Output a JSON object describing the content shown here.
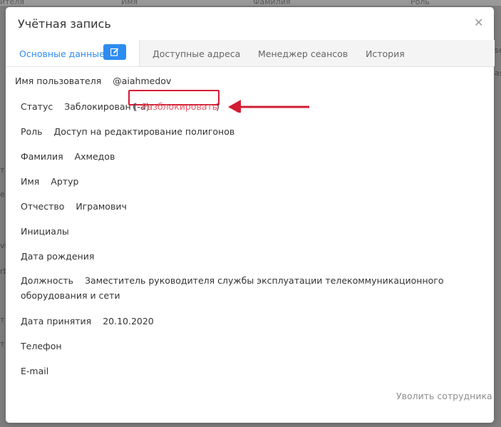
{
  "background": {
    "header_cells": [
      "ителя",
      "Имя",
      "Фамилия",
      "Роль"
    ],
    "edge_fragments": [
      "т",
      "е",
      "vi",
      "rb",
      "т",
      "т"
    ],
    "right_fragments": [
      "se",
      "as"
    ]
  },
  "modal": {
    "title": "Учётная запись",
    "tabs": [
      {
        "label": "Основные данные"
      },
      {
        "label": "Доступные адреса"
      },
      {
        "label": "Менеджер сеансов"
      },
      {
        "label": "История"
      }
    ],
    "fields": {
      "username": {
        "label": "Имя пользователя",
        "value": "@aiahmedov"
      },
      "status": {
        "label": "Статус",
        "value": "Заблокирован (-а)",
        "paren_open": "(",
        "paren_close": ")",
        "action": "Разблокировать"
      },
      "role": {
        "label": "Роль",
        "value": "Доступ на редактирование полигонов"
      },
      "lastname": {
        "label": "Фамилия",
        "value": "Ахмедов"
      },
      "firstname": {
        "label": "Имя",
        "value": "Артур"
      },
      "patronymic": {
        "label": "Отчество",
        "value": "Играмович"
      },
      "initials": {
        "label": "Инициалы",
        "value": ""
      },
      "birthdate": {
        "label": "Дата рождения",
        "value": ""
      },
      "position": {
        "label": "Должность",
        "value": "Заместитель руководителя службы эксплуатации телекоммуникационного оборудования и сети"
      },
      "hiredate": {
        "label": "Дата принятия",
        "value": "20.10.2020"
      },
      "phone": {
        "label": "Телефон",
        "value": ""
      },
      "email": {
        "label": "E-mail",
        "value": ""
      }
    },
    "fire_label": "Уволить сотрудника"
  },
  "colors": {
    "accent": "#2d8cf0",
    "annotation_red": "#d21d33",
    "link_red": "#e85a68"
  }
}
